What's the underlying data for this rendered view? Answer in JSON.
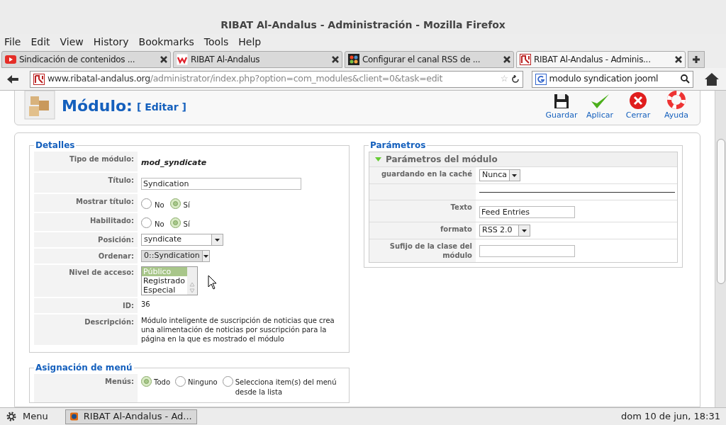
{
  "window": {
    "title": "RIBAT Al-Andalus - Administración - Mozilla Firefox"
  },
  "menu": [
    "File",
    "Edit",
    "View",
    "History",
    "Bookmarks",
    "Tools",
    "Help"
  ],
  "tabs": [
    {
      "label": "Sindicación de contenidos ...",
      "selected": false,
      "kind": "video"
    },
    {
      "label": "RIBAT Al-Andalus",
      "selected": false,
      "kind": "w"
    },
    {
      "label": "Configurar el canal RSS de ...",
      "selected": false,
      "kind": "joomla"
    },
    {
      "label": "RIBAT Al-Andalus - Adminis...",
      "selected": true,
      "kind": "ribat"
    }
  ],
  "url": {
    "host": "www.ribatal-andalus.org",
    "path": "/administrator/index.php?option=com_modules&client=0&task=edit"
  },
  "search": {
    "value": "modulo syndication jooml"
  },
  "bookmark_star": "☆",
  "toolbar": {
    "title": "Módulo:",
    "subtitle": "[ Editar ]",
    "buttons": [
      {
        "label": "Guardar",
        "kind": "save"
      },
      {
        "label": "Aplicar",
        "kind": "apply"
      },
      {
        "label": "Cerrar",
        "kind": "close"
      },
      {
        "label": "Ayuda",
        "kind": "help"
      }
    ]
  },
  "details": {
    "legend": "Detalles",
    "rows": [
      {
        "label": "Tipo de módulo:",
        "kind": "strong",
        "value": "mod_syndicate"
      },
      {
        "label": "Título:",
        "kind": "input",
        "value": "Syndication"
      },
      {
        "label": "Mostrar título:",
        "kind": "radio",
        "options": [
          {
            "label": "No",
            "selected": false
          },
          {
            "label": "Sí",
            "selected": true
          }
        ]
      },
      {
        "label": "Habilitado:",
        "kind": "radio",
        "options": [
          {
            "label": "No",
            "selected": false
          },
          {
            "label": "Sí",
            "selected": true
          }
        ]
      },
      {
        "label": "Posición:",
        "kind": "select",
        "value": "syndicate",
        "disabled": false
      },
      {
        "label": "Ordenar:",
        "kind": "select",
        "value": "0::Syndication",
        "disabled": true
      },
      {
        "label": "Nivel de acceso:",
        "kind": "listbox",
        "options": [
          {
            "label": "Público",
            "selected": true
          },
          {
            "label": "Registrado",
            "selected": false
          },
          {
            "label": "Especial",
            "selected": false
          }
        ]
      },
      {
        "label": "ID:",
        "kind": "text",
        "value": "36"
      },
      {
        "label": "Descripción:",
        "kind": "text",
        "value": "Módulo inteligente de suscripción de noticias que crea una alimentación de noticias por suscripción para la página en la que es mostrado el módulo"
      }
    ]
  },
  "menu_assignment": {
    "legend": "Asignación de menú",
    "label": "Menús:",
    "options": [
      {
        "label": "Todo",
        "selected": true
      },
      {
        "label": "Ninguno",
        "selected": false
      },
      {
        "label": "Selecciona item(s) del menú desde la lista",
        "selected": false
      }
    ]
  },
  "parameters": {
    "legend": "Parámetros",
    "panel": {
      "title": "Parámetros del módulo",
      "expanded": true
    },
    "rows": [
      {
        "label": "guardando en la caché",
        "kind": "select",
        "value": "Nunca"
      },
      {
        "kind": "separator"
      },
      {
        "label": "Texto",
        "kind": "input",
        "value": "Feed Entries"
      },
      {
        "label": "formato",
        "kind": "select",
        "value": "RSS 2.0"
      },
      {
        "label": "Sufijo de la clase del módulo",
        "kind": "input",
        "value": ""
      }
    ]
  },
  "taskbar": {
    "menu": "Menu",
    "window": "RIBAT Al-Andalus - Ad...",
    "clock": "dom 10 de jun, 18:31"
  }
}
